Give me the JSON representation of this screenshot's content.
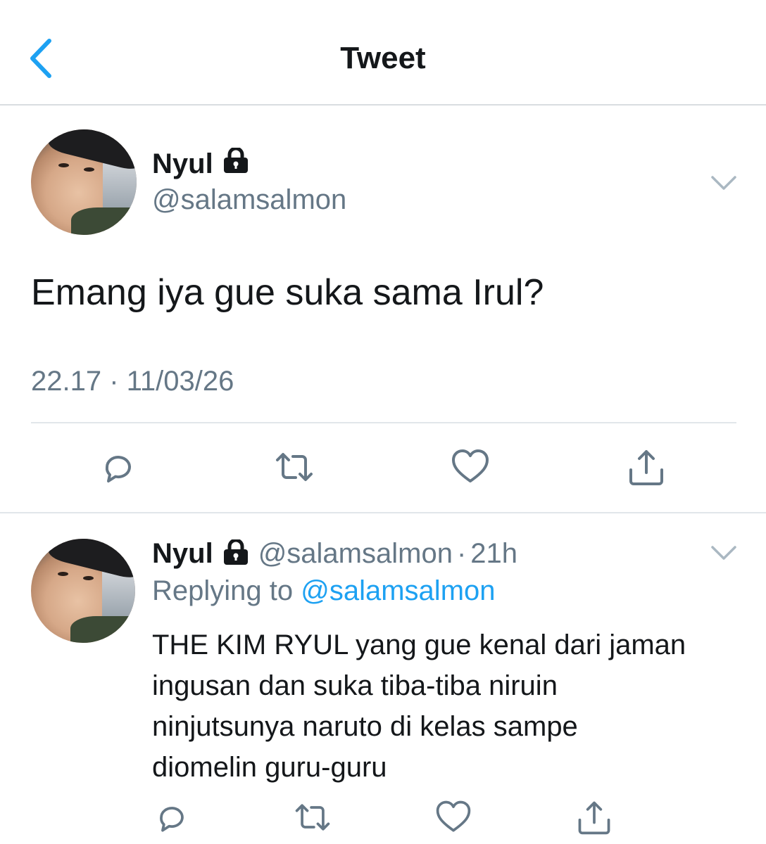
{
  "header": {
    "title": "Tweet",
    "back_icon": "chevron-left-icon"
  },
  "accent_color": "#1da1f2",
  "main_tweet": {
    "display_name": "Nyul",
    "handle": "@salamsalmon",
    "text": "Emang iya gue suka sama Irul?",
    "timestamp": "22.17 · 11/03/26",
    "actions": [
      "reply-icon",
      "retweet-icon",
      "like-icon",
      "share-icon"
    ]
  },
  "reply_tweet": {
    "display_name": "Nyul",
    "handle": "@salamsalmon",
    "separator": "·",
    "time": "21h",
    "replying_prefix": "Replying to",
    "replying_to": "@salamsalmon",
    "lines": [
      "THE KIM RYUL yang gue kenal dari jaman",
      "ingusan dan suka tiba-tiba niruin",
      "ninjutsunya naruto di kelas sampe",
      "diomelin guru-guru"
    ],
    "actions": [
      "reply-icon",
      "retweet-icon",
      "like-icon",
      "share-icon"
    ]
  }
}
